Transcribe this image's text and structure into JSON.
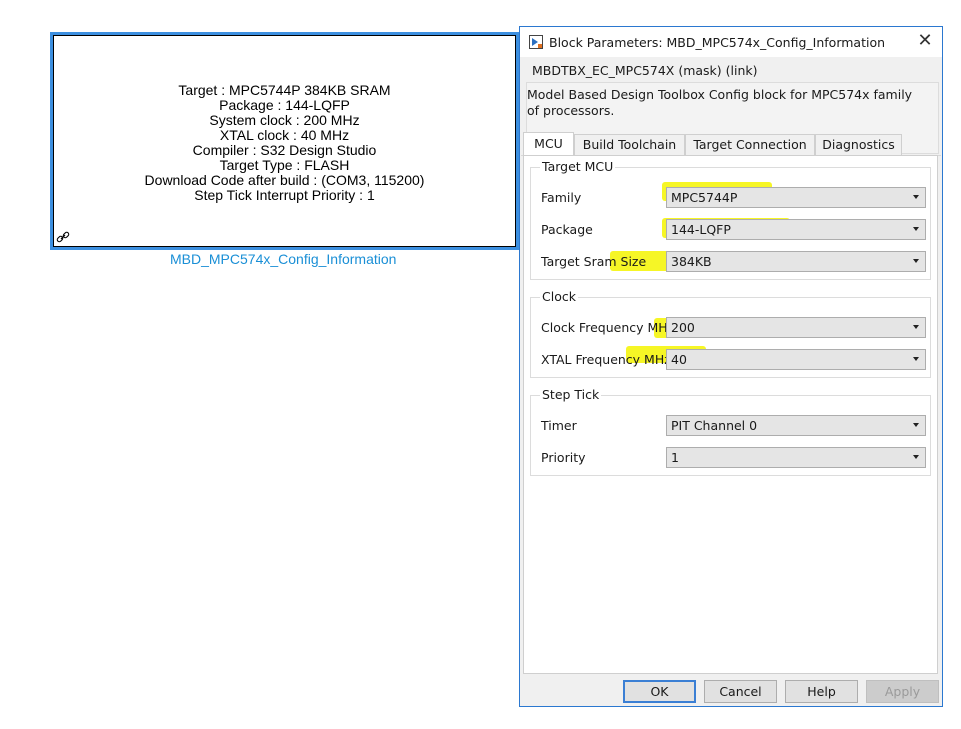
{
  "block": {
    "lines": [
      "Target : MPC5744P 384KB SRAM",
      "Package : 144-LQFP",
      "System clock : 200 MHz",
      "XTAL clock : 40 MHz",
      "Compiler : S32 Design Studio",
      "Target Type : FLASH",
      "Download Code after build : (COM3, 115200)",
      "Step Tick Interrupt Priority : 1"
    ],
    "name": "MBD_MPC574x_Config_Information",
    "link_icon": "link-icon"
  },
  "dialog": {
    "title": "Block Parameters: MBD_MPC574x_Config_Information",
    "title_icon": "simulink-block-icon",
    "close_icon": "close-icon",
    "mask_title": "MBDTBX_EC_MPC574X (mask) (link)",
    "mask_description": "Model Based Design Toolbox Config block for MPC574x family of processors.",
    "tabs": [
      {
        "label": "MCU",
        "active": true
      },
      {
        "label": "Build Toolchain",
        "active": false
      },
      {
        "label": "Target Connection",
        "active": false
      },
      {
        "label": "Diagnostics",
        "active": false
      }
    ],
    "groups": {
      "target_mcu": {
        "title": "Target MCU",
        "family": {
          "label": "Family",
          "value": "MPC5744P"
        },
        "package": {
          "label": "Package",
          "value": "144-LQFP"
        },
        "sram": {
          "label": "Target Sram Size",
          "value": "384KB"
        }
      },
      "clock": {
        "title": "Clock",
        "frequency": {
          "label": "Clock Frequency MHz",
          "value": "200"
        },
        "xtal": {
          "label": "XTAL Frequency MHz",
          "value": "40"
        }
      },
      "step_tick": {
        "title": "Step Tick",
        "timer": {
          "label": "Timer",
          "value": "PIT Channel 0"
        },
        "priority": {
          "label": "Priority",
          "value": "1"
        }
      }
    },
    "buttons": {
      "ok": "OK",
      "cancel": "Cancel",
      "help": "Help",
      "apply": "Apply"
    },
    "highlight_color": "#f4f500",
    "accent_color": "#2b78d0"
  }
}
